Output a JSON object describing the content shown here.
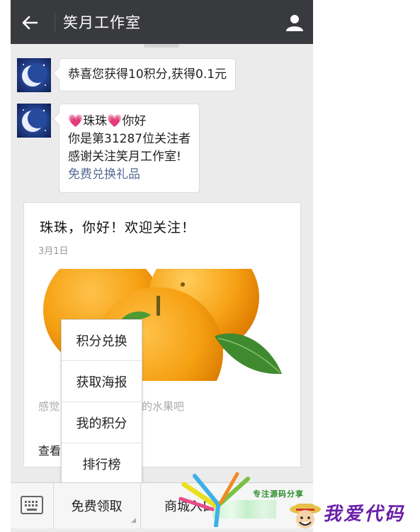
{
  "header": {
    "title": "笑月工作室",
    "back_icon": "arrow-left-icon",
    "profile_icon": "person-icon"
  },
  "messages": [
    {
      "lines": [
        "恭喜您获得10积分,获得0.1元"
      ]
    },
    {
      "greeting_name": "珠珠",
      "greeting_tail": "你好",
      "line2": "你是第31287位关注者",
      "line3": "感谢关注笑月工作室!",
      "link": "免费兑换礼品"
    }
  ],
  "article": {
    "title": "珠珠，你好！欢迎关注！",
    "date": "3月1日",
    "desc_start": "感觉",
    "desc_end": "的水果吧",
    "more": "查看"
  },
  "popup_menu": {
    "items": [
      "积分兑换",
      "获取海报",
      "我的积分",
      "排行榜"
    ]
  },
  "bottom_menu": {
    "keyboard_icon": "keyboard-icon",
    "buttons": [
      "免费领取",
      "商城入口"
    ]
  },
  "watermark": {
    "sub": "专注源码分享",
    "main": "我爱代码"
  },
  "colors": {
    "topbar": "#393a3e",
    "chat_bg": "#ebebeb",
    "link": "#576b95",
    "watermark": "#6a1fa8"
  }
}
